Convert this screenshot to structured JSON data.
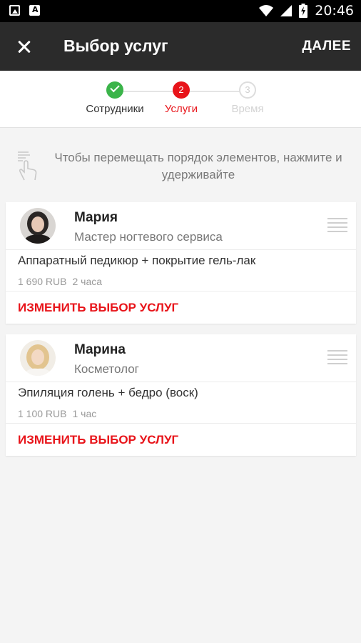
{
  "status_bar": {
    "time": "20:46"
  },
  "app_bar": {
    "title": "Выбор услуг",
    "next_label": "ДАЛЕЕ"
  },
  "stepper": {
    "steps": [
      {
        "number": "1",
        "label": "Сотрудники",
        "state": "done"
      },
      {
        "number": "2",
        "label": "Услуги",
        "state": "active"
      },
      {
        "number": "3",
        "label": "Время",
        "state": "pending"
      }
    ]
  },
  "hint": {
    "text": "Чтобы перемещать порядок элементов, нажмите и удерживайте"
  },
  "cards": [
    {
      "employee_name": "Мария",
      "employee_role": "Мастер ногтевого сервиса",
      "service_name": "Аппаратный педикюр + покрытие гель-лак",
      "price": "1 690 RUB",
      "duration": "2 часа",
      "change_label": "ИЗМЕНИТЬ ВЫБОР УСЛУГ"
    },
    {
      "employee_name": "Марина",
      "employee_role": "Косметолог",
      "service_name": "Эпиляция голень + бедро (воск)",
      "price": "1 100 RUB",
      "duration": "1 час",
      "change_label": "ИЗМЕНИТЬ ВЫБОР УСЛУГ"
    }
  ],
  "colors": {
    "accent": "#e8141a",
    "done": "#3bb44a",
    "appbar": "#2b2b2b"
  }
}
